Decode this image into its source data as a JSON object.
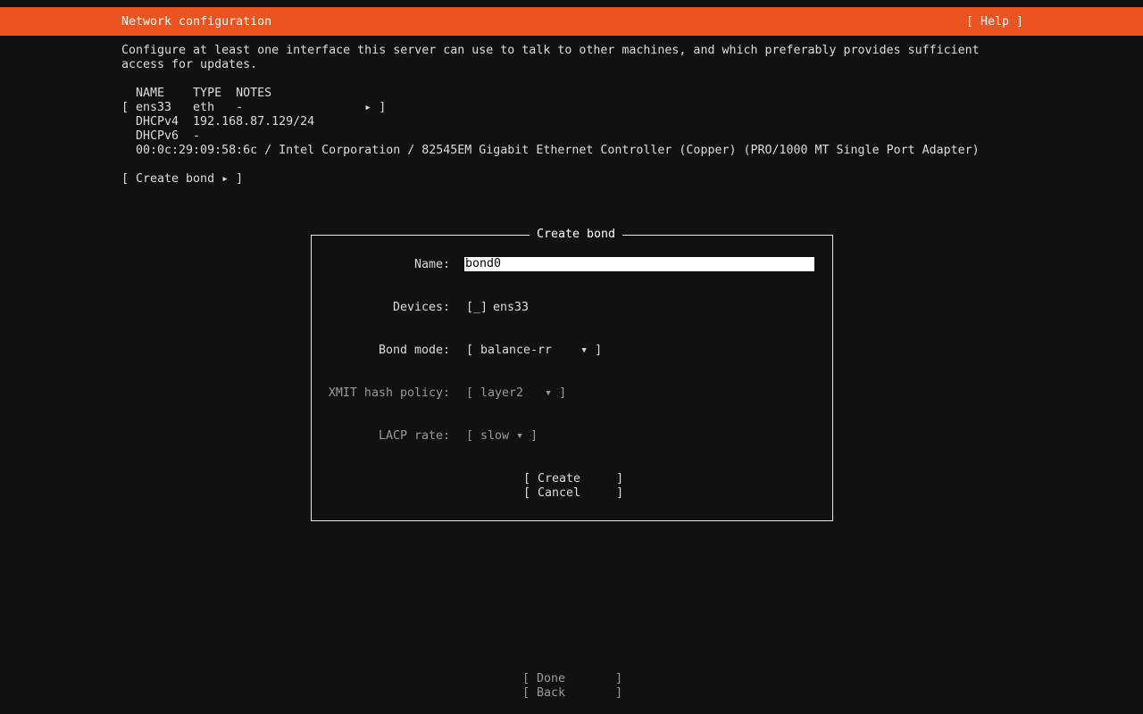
{
  "header": {
    "title": "Network configuration",
    "help_label": "[ Help ]"
  },
  "intro": {
    "line1": "Configure at least one interface this server can use to talk to other machines, and which preferably provides sufficient",
    "line2": "access for updates."
  },
  "interfaces": {
    "columns_header": "  NAME    TYPE  NOTES",
    "row_main": "[ ens33   eth   -                 ▸ ]",
    "dhcpv4": "  DHCPv4  192.168.87.129/24",
    "dhcpv6": "  DHCPv6  -",
    "hw_info": "  00:0c:29:09:58:6c / Intel Corporation / 82545EM Gigabit Ethernet Controller (Copper) (PRO/1000 MT Single Port Adapter)"
  },
  "create_bond_action": "[ Create bond ▸ ]",
  "dialog": {
    "title": "Create bond",
    "name_label": "Name:",
    "name_value": "bond0",
    "devices_label": "Devices:",
    "device_checkbox": "[_]",
    "device_name": "ens33",
    "bond_mode_label": "Bond mode:",
    "bond_mode_value": "[ balance-rr    ▾ ]",
    "xmit_label": "XMIT hash policy:",
    "xmit_value": "[ layer2   ▾ ]",
    "lacp_label": "LACP rate:",
    "lacp_value": "[ slow ▾ ]",
    "create_label": "[ Create     ]",
    "cancel_label": "[ Cancel     ]"
  },
  "footer": {
    "done_label": "[ Done       ]",
    "back_label": "[ Back       ]"
  },
  "colors": {
    "header_bg": "#e95420",
    "page_bg": "#111111",
    "text": "#dcdcdc",
    "dim_text": "#9a9a9a"
  }
}
